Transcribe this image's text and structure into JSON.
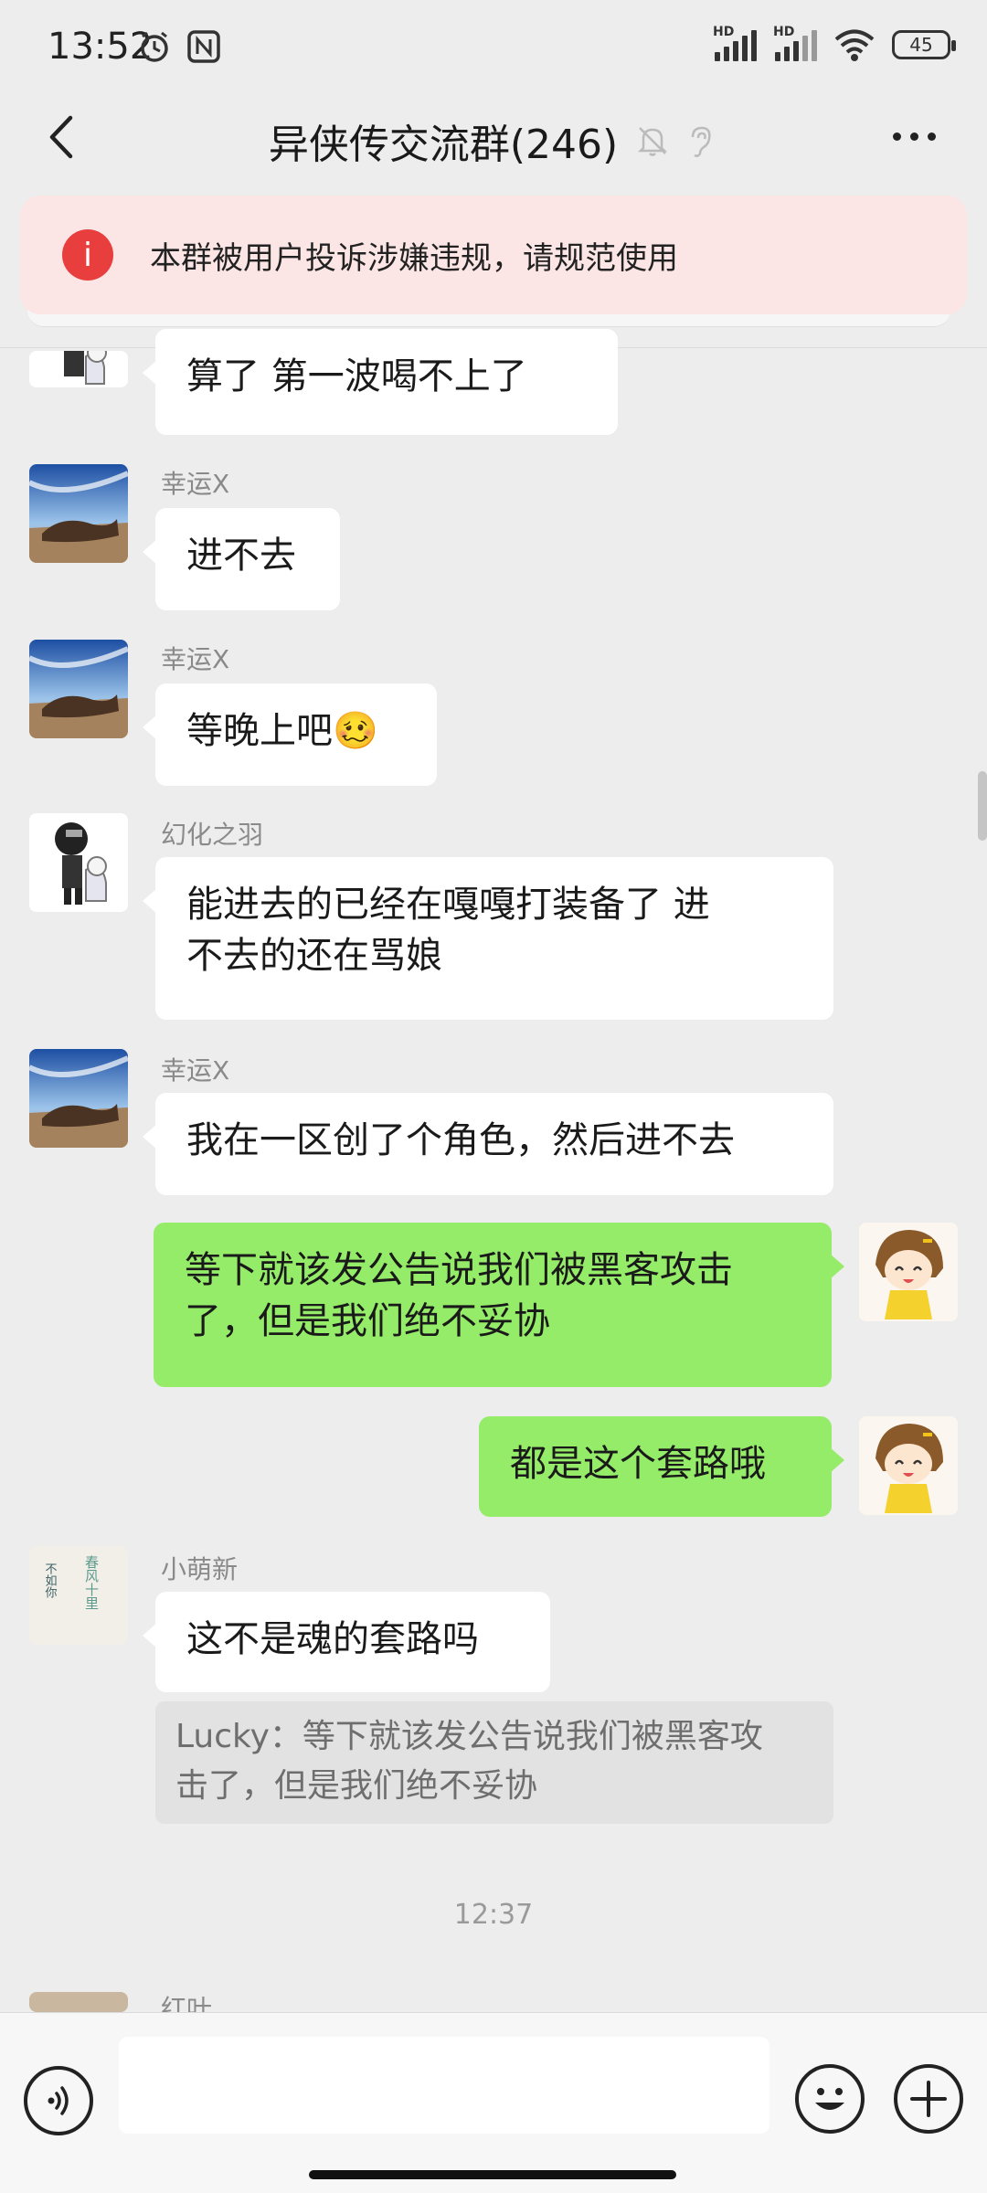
{
  "status_bar": {
    "time": "13:52",
    "battery": "45",
    "hd": "HD"
  },
  "header": {
    "title": "异侠传交流群(246)"
  },
  "warning": {
    "text": "本群被用户投诉涉嫌违规，请规范使用"
  },
  "messages": [
    {
      "type": "left",
      "sender": "",
      "text": "算了  第一波喝不上了"
    },
    {
      "type": "left",
      "sender": "幸运X",
      "text": "进不去"
    },
    {
      "type": "left",
      "sender": "幸运X",
      "text": "等晚上吧🥴"
    },
    {
      "type": "left",
      "sender": "幻化之羽",
      "line1": "能进去的已经在嘎嘎打装备了  进",
      "line2": "不去的还在骂娘"
    },
    {
      "type": "left",
      "sender": "幸运X",
      "text": "我在一区创了个角色，然后进不去"
    },
    {
      "type": "right",
      "line1": "等下就该发公告说我们被黑客攻击",
      "line2": "了，但是我们绝不妥协"
    },
    {
      "type": "right",
      "text": "都是这个套路哦"
    },
    {
      "type": "left",
      "sender": "小萌新",
      "text": "这不是魂的套路吗",
      "quote_line1": "Lucky：等下就该发公告说我们被黑客攻",
      "quote_line2": "击了，但是我们绝不妥协"
    },
    {
      "type": "left",
      "sender": "红叶",
      "text": ""
    }
  ],
  "timestamp": "12:37",
  "avatar_text": {
    "calligraphy_left": "不如你",
    "calligraphy_right": "春风十里"
  },
  "colors": {
    "my_bubble": "#95EC69",
    "other_bubble": "#FFFFFF",
    "background": "#EDEDED",
    "warning_bg": "#FCE5E5",
    "warning_icon": "#E83E3E"
  }
}
